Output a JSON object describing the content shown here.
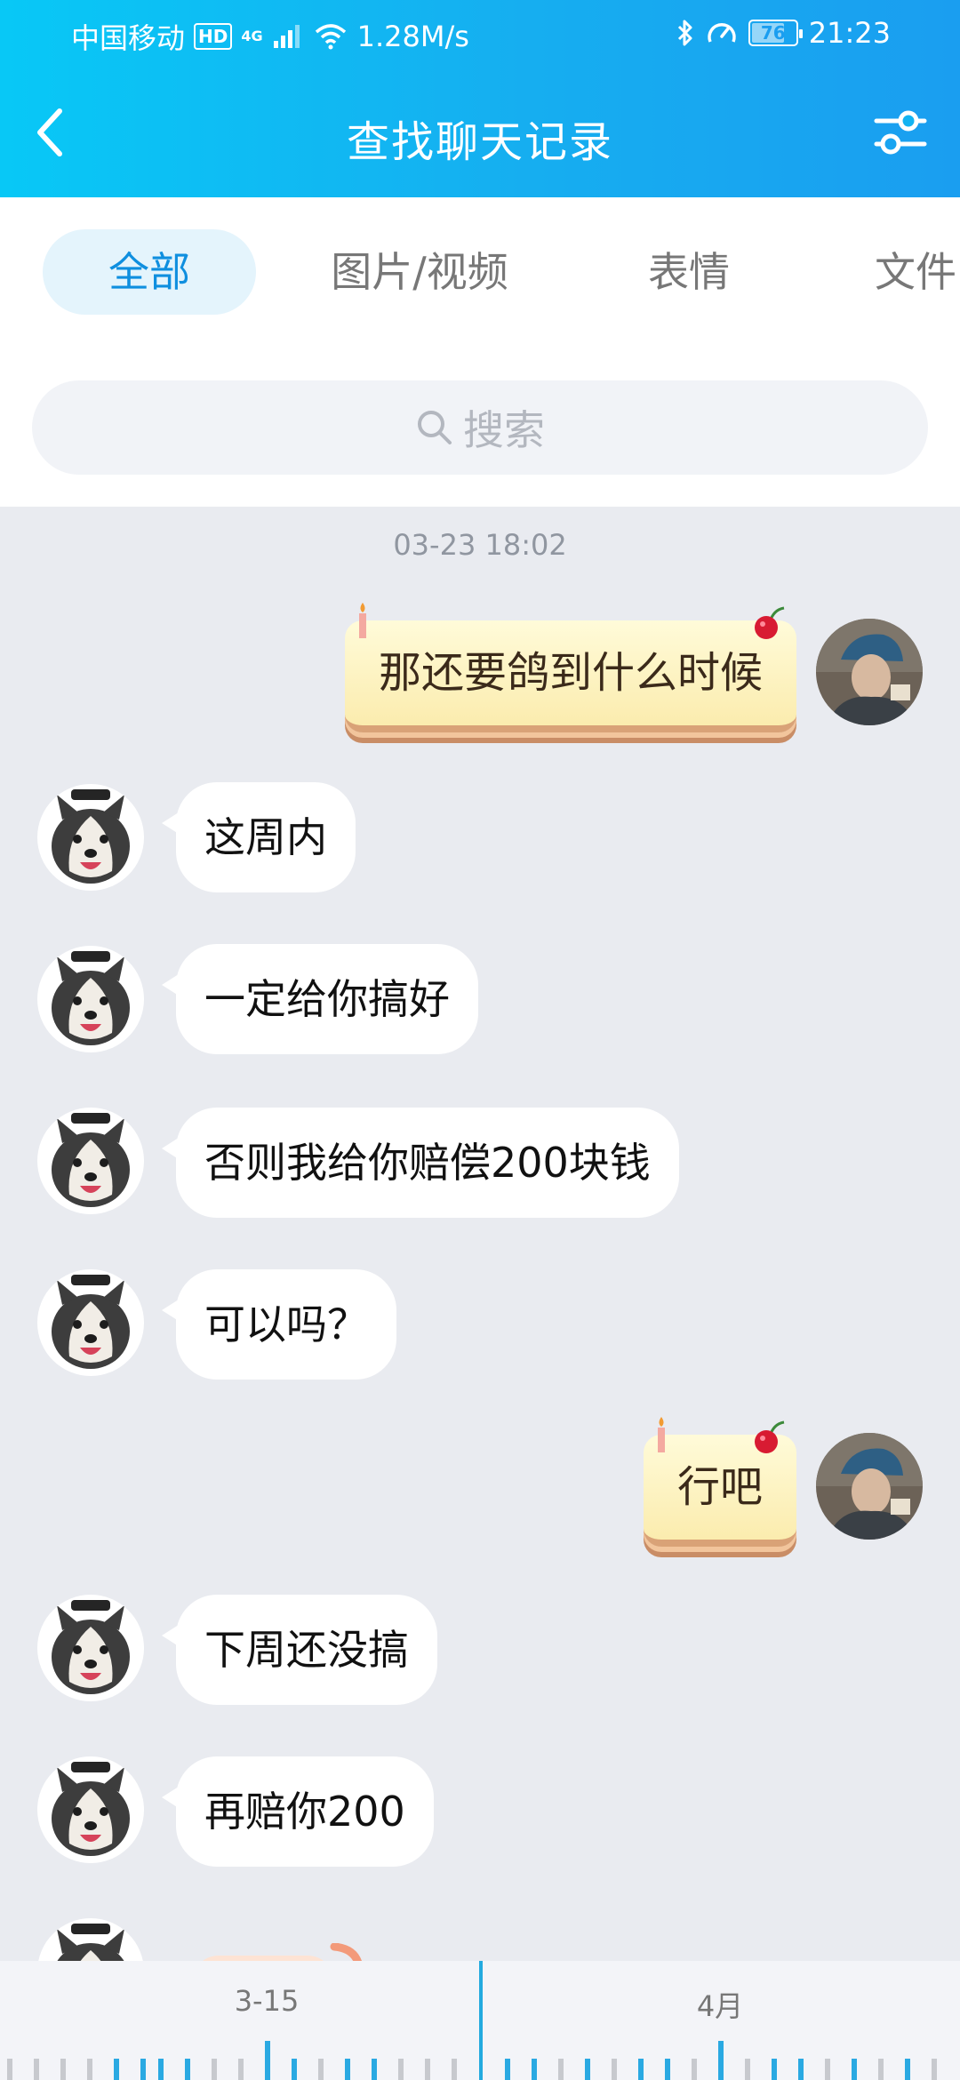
{
  "status_bar": {
    "carrier": "中国移动",
    "hd": "HD",
    "network": "4G",
    "speed": "1.28M/s",
    "battery": "76",
    "time": "21:23"
  },
  "header": {
    "title": "查找聊天记录"
  },
  "tabs": [
    {
      "label": "全部",
      "active": true
    },
    {
      "label": "图片/视频",
      "active": false
    },
    {
      "label": "表情",
      "active": false
    },
    {
      "label": "文件",
      "active": false
    }
  ],
  "search": {
    "placeholder": "搜索"
  },
  "chat": {
    "timestamp": "03-23 18:02",
    "messages": [
      {
        "side": "right",
        "text": "那还要鸽到什么时候"
      },
      {
        "side": "left",
        "text": "这周内"
      },
      {
        "side": "left",
        "text": "一定给你搞好"
      },
      {
        "side": "left",
        "text": "否则我给你赔偿200块钱"
      },
      {
        "side": "left",
        "text": "可以吗？"
      },
      {
        "side": "right",
        "text": "行吧"
      },
      {
        "side": "left",
        "text": "下周还没搞"
      },
      {
        "side": "left",
        "text": "再赔你200"
      }
    ]
  },
  "timeline": {
    "labels": [
      "3-15",
      "4月"
    ]
  },
  "colors": {
    "header_start": "#08c8f6",
    "header_end": "#1a9ef0",
    "active_tab_bg": "#e4f4fc",
    "active_tab_text": "#0f8fdf",
    "chat_bg": "#e9ebf0",
    "timeline_cursor": "#23aadf"
  }
}
